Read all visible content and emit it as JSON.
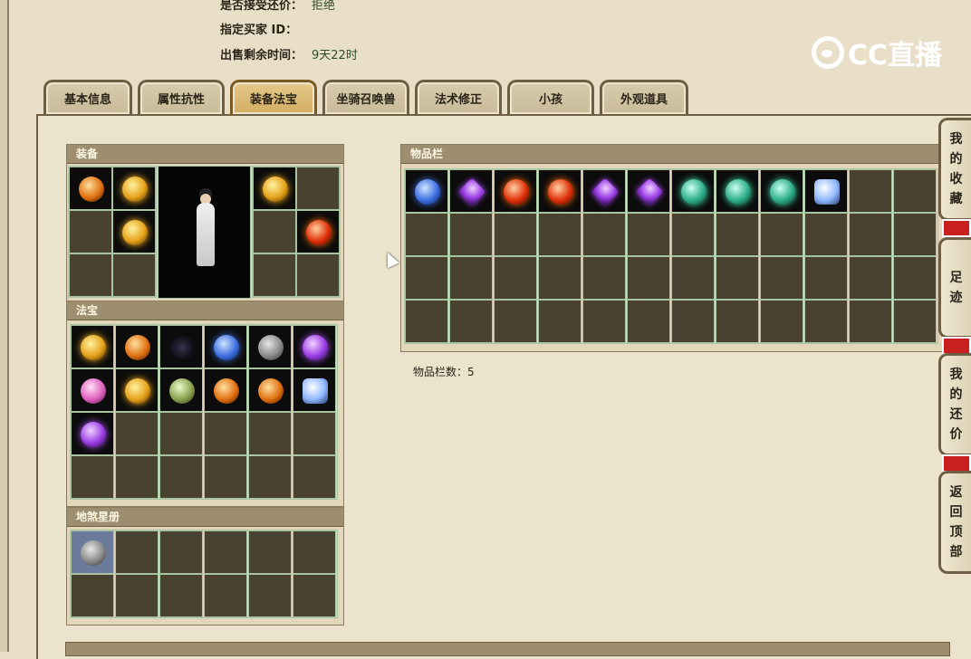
{
  "header_info": [
    {
      "label": "是否接受还价：",
      "value": "拒绝"
    },
    {
      "label": "指定买家 ID：",
      "value": ""
    },
    {
      "label": "出售剩余时间：",
      "value": "9天22时"
    }
  ],
  "watermark": "CC直播",
  "tabs": [
    "基本信息",
    "属性抗性",
    "装备法宝",
    "坐骑召唤兽",
    "法术修正",
    "小孩",
    "外观道具"
  ],
  "active_tab": "装备法宝",
  "sections": {
    "equipment": {
      "title": "装备"
    },
    "fabao": {
      "title": "法宝"
    },
    "disha": {
      "title": "地煞星册"
    },
    "inventory": {
      "title": "物品栏",
      "count_label": "物品栏数：5"
    }
  },
  "side_tabs": [
    "我的收藏",
    "足迹",
    "我的还价",
    "返回顶部"
  ],
  "colors": {
    "accent_tab": "#d3ad62",
    "panel_bg": "#ece3cd",
    "side_separator": "#c82020"
  },
  "icons": {
    "equipment": [
      "hat-icon",
      "crown-icon",
      "necklace-icon",
      "armor-icon",
      "weapon-icon",
      "belt-icon"
    ],
    "fabao": [
      "fabao-lantern-icon",
      "fabao-pipa-icon",
      "fabao-orb-icon",
      "fabao-claw-icon",
      "fabao-scroll-icon",
      "fabao-cloth-icon",
      "fabao-bell-icon",
      "fabao-flame-icon",
      "fabao-urn-icon",
      "fabao-tablet-icon",
      "fabao-sword-icon",
      "fabao-whisk-icon",
      "fabao-ring-icon"
    ],
    "inventory": [
      "blue-crystal-icon",
      "purple-crystal-icon",
      "red-orb-icon",
      "red-orb-icon",
      "purple-crystal-icon",
      "purple-crystal-icon",
      "teal-orb-icon",
      "teal-orb-icon",
      "teal-orb-icon",
      "ice-crystal-icon"
    ],
    "disha": [
      "star-card-portrait-icon"
    ]
  }
}
